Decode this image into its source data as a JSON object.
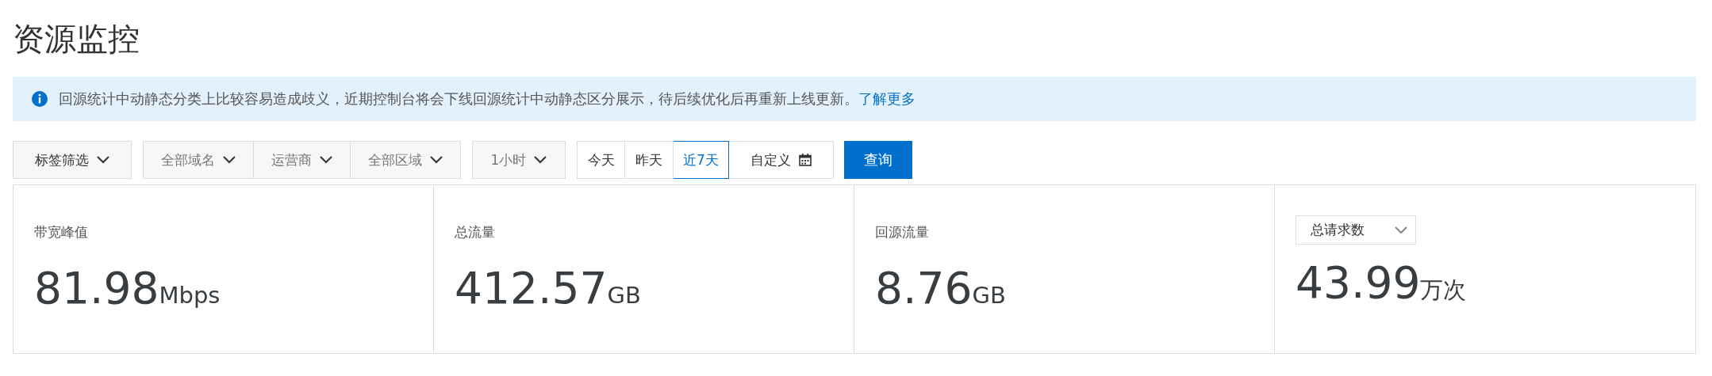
{
  "page_title": "资源监控",
  "notice": {
    "text": "回源统计中动静态分类上比较容易造成歧义，近期控制台将会下线回源统计中动静态区分展示，待后续优化后再重新上线更新。",
    "link": "了解更多"
  },
  "filters": {
    "tag_filter": "标签筛选",
    "selects": [
      {
        "label": "全部域名"
      },
      {
        "label": "运营商"
      },
      {
        "label": "全部区域"
      }
    ],
    "interval": "1小时",
    "ranges": [
      {
        "label": "今天",
        "selected": false
      },
      {
        "label": "昨天",
        "selected": false
      },
      {
        "label": "近7天",
        "selected": true
      }
    ],
    "custom": "自定义",
    "query_button": "查询"
  },
  "metrics": [
    {
      "kind": "label",
      "label": "带宽峰值",
      "value": "81.98",
      "unit": "Mbps"
    },
    {
      "kind": "label",
      "label": "总流量",
      "value": "412.57",
      "unit": "GB"
    },
    {
      "kind": "label",
      "label": "回源流量",
      "value": "8.76",
      "unit": "GB"
    },
    {
      "kind": "select",
      "label": "总请求数",
      "value": "43.99",
      "unit": "万次"
    }
  ]
}
